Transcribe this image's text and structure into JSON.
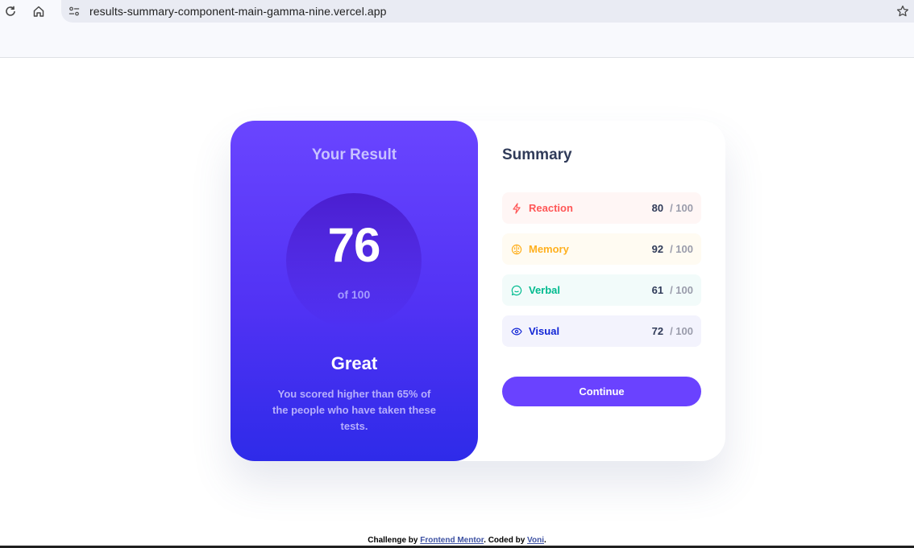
{
  "browser": {
    "url": "results-summary-component-main-gamma-nine.vercel.app"
  },
  "result": {
    "title": "Your Result",
    "score": "76",
    "score_of": "of 100",
    "rating": "Great",
    "description": "You scored higher than 65% of the people who have taken these tests."
  },
  "summary": {
    "title": "Summary",
    "items": [
      {
        "label": "Reaction",
        "score": "80",
        "max": "/ 100",
        "icon": "lightning-icon",
        "color": "#ff5757",
        "bg": "#fff6f5"
      },
      {
        "label": "Memory",
        "score": "92",
        "max": "/ 100",
        "icon": "brain-icon",
        "color": "#ffb01f",
        "bg": "#fffbf2"
      },
      {
        "label": "Verbal",
        "score": "61",
        "max": "/ 100",
        "icon": "chat-bubble-icon",
        "color": "#00bb8f",
        "bg": "#f2fbfa"
      },
      {
        "label": "Visual",
        "score": "72",
        "max": "/ 100",
        "icon": "eye-icon",
        "color": "#1125d6",
        "bg": "#f3f3fd"
      }
    ],
    "button_label": "Continue"
  },
  "attribution": {
    "prefix": "Challenge by ",
    "link1": "Frontend Mentor",
    "middle": ". Coded by ",
    "link2": "Voni",
    "suffix": "."
  }
}
